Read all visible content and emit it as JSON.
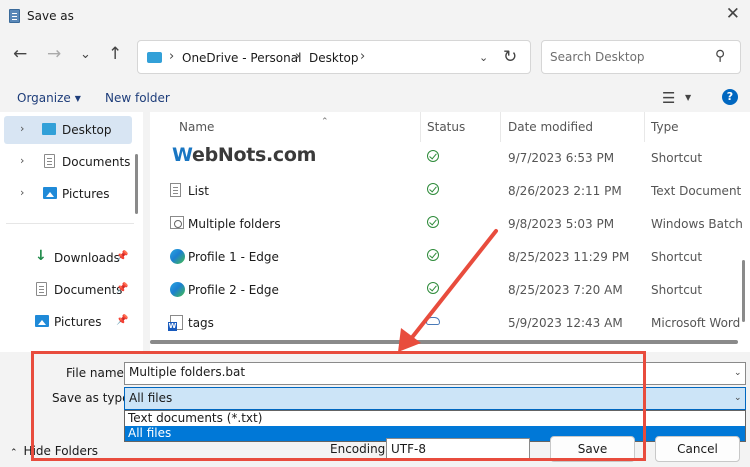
{
  "window": {
    "title": "Save as"
  },
  "address": {
    "crumbs": [
      "OneDrive - Personal",
      "Desktop"
    ]
  },
  "search": {
    "placeholder": "Search Desktop"
  },
  "toolbar": {
    "organize_label": "Organize",
    "new_folder_label": "New folder",
    "help": "?"
  },
  "sidebar": {
    "items": [
      {
        "label": "Desktop",
        "icon": "desktop-icon",
        "selected": true
      },
      {
        "label": "Documents",
        "icon": "documents-icon"
      },
      {
        "label": "Pictures",
        "icon": "pictures-icon"
      },
      {
        "label": "Downloads",
        "icon": "downloads-icon",
        "pinned": true
      },
      {
        "label": "Documents",
        "icon": "documents-icon",
        "pinned": true
      },
      {
        "label": "Pictures",
        "icon": "pictures-icon",
        "pinned": true
      }
    ]
  },
  "columns": {
    "name": "Name",
    "status": "Status",
    "date": "Date modified",
    "type": "Type"
  },
  "watermark": {
    "w": "W",
    "rest": "ebNots.com"
  },
  "files": [
    {
      "name": "",
      "status": "synced",
      "date": "9/7/2023 6:53 PM",
      "type": "Shortcut",
      "icon": "shortcut-icon"
    },
    {
      "name": "List",
      "status": "synced",
      "date": "8/26/2023 2:11 PM",
      "type": "Text Document",
      "icon": "text-document-icon"
    },
    {
      "name": "Multiple folders",
      "status": "synced",
      "date": "9/8/2023 5:03 PM",
      "type": "Windows Batch",
      "icon": "batch-file-icon"
    },
    {
      "name": "Profile 1 - Edge",
      "status": "synced",
      "date": "8/25/2023 11:29 PM",
      "type": "Shortcut",
      "icon": "edge-icon"
    },
    {
      "name": "Profile 2 - Edge",
      "status": "synced",
      "date": "8/25/2023 7:20 AM",
      "type": "Shortcut",
      "icon": "edge-icon"
    },
    {
      "name": "tags",
      "status": "cloud",
      "date": "5/9/2023 12:43 AM",
      "type": "Microsoft Word",
      "icon": "word-document-icon"
    }
  ],
  "form": {
    "file_name_label": "File name:",
    "file_name_value": "Multiple folders.bat",
    "save_as_type_label": "Save as type:",
    "save_as_type_value": "All files",
    "type_options": [
      "Text documents (*.txt)",
      "All files"
    ],
    "type_selected_index": 1,
    "hide_folders_label": "Hide Folders",
    "encoding_label": "Encoding:",
    "encoding_value": "UTF-8",
    "save_label": "Save",
    "cancel_label": "Cancel"
  },
  "colors": {
    "accent": "#0067c0",
    "annotation": "#e84c3d",
    "selection": "#0078d7"
  }
}
